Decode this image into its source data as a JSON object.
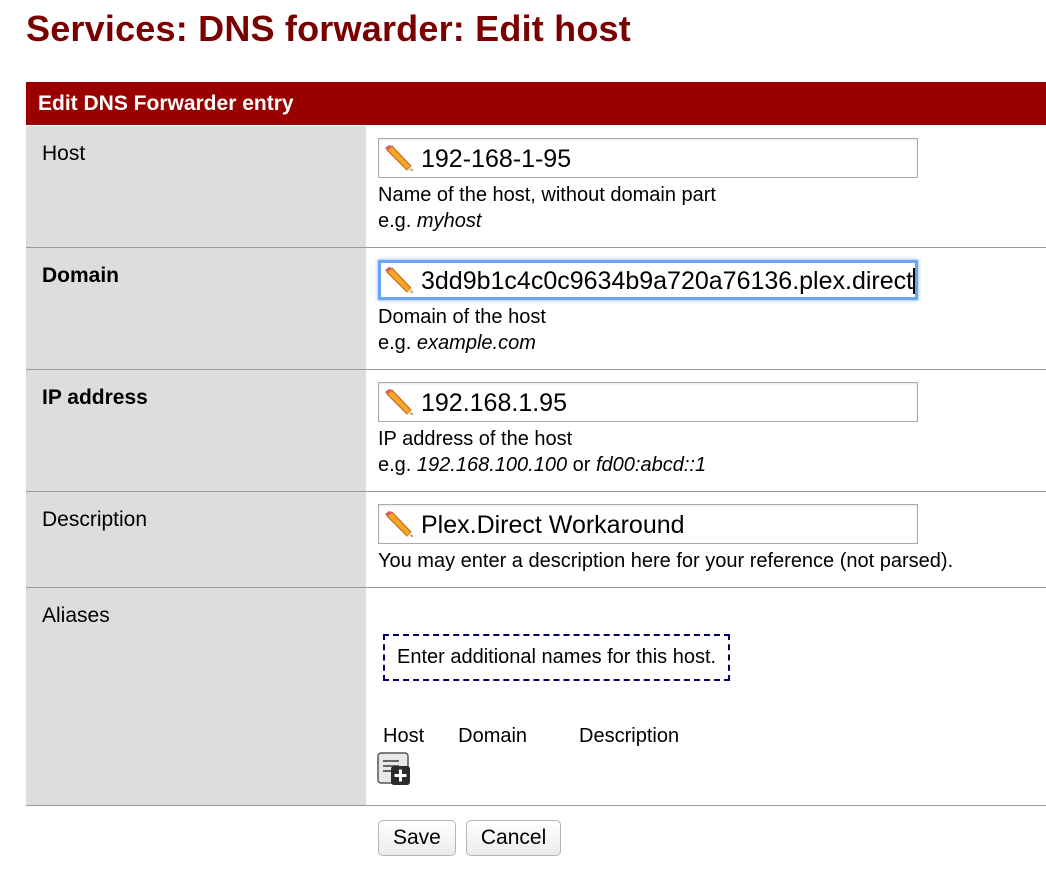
{
  "page": {
    "title": "Services: DNS forwarder: Edit host"
  },
  "section": {
    "header": "Edit DNS Forwarder entry"
  },
  "fields": {
    "host": {
      "label": "Host",
      "value": "192-168-1-95",
      "help_line1": "Name of the host, without domain part",
      "help_prefix": "e.g. ",
      "help_example": "myhost"
    },
    "domain": {
      "label": "Domain",
      "value": "3dd9b1c4c0c9634b9a720a76136.plex.direct",
      "help_line1": "Domain of the host",
      "help_prefix": "e.g. ",
      "help_example": "example.com"
    },
    "ip": {
      "label": "IP address",
      "value": "192.168.1.95",
      "help_line1": "IP address of the host",
      "help_prefix": "e.g. ",
      "help_example1": "192.168.100.100",
      "help_or": " or ",
      "help_example2": "fd00:abcd::1"
    },
    "description": {
      "label": "Description",
      "value": "Plex.Direct Workaround",
      "help_line1": "You may enter a description here for your reference (not parsed)."
    }
  },
  "aliases": {
    "label": "Aliases",
    "info": "Enter additional names for this host.",
    "columns": [
      "Host",
      "Domain",
      "Description"
    ],
    "add_icon": "add-row-icon"
  },
  "buttons": {
    "save": "Save",
    "cancel": "Cancel"
  },
  "colors": {
    "title": "#7a0000",
    "header_bg": "#990000",
    "label_bg": "#dddddd",
    "focus": "#6aa4f0"
  }
}
